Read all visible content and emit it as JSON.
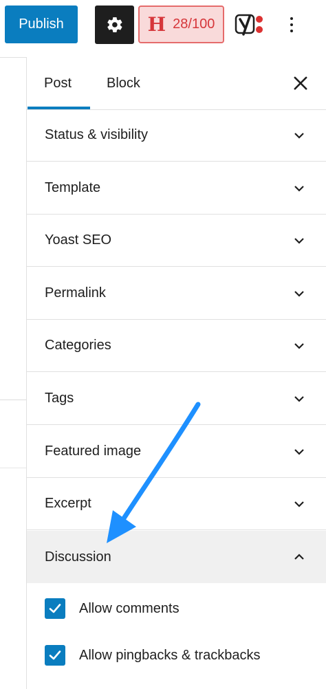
{
  "toolbar": {
    "publish_label": "Publish",
    "hemingway_score": "28/100",
    "icons": [
      "settings-gear-icon",
      "hemingway-h-icon",
      "yoast-icon",
      "more-options-icon"
    ],
    "colors": {
      "publish": "#0a7dbf",
      "settings_active": "#1e1e1e",
      "hemingway_bg": "#f9dada",
      "hemingway_text": "#d6363a"
    }
  },
  "sidebar": {
    "tabs": [
      {
        "label": "Post",
        "active": true
      },
      {
        "label": "Block",
        "active": false
      }
    ],
    "panels": [
      {
        "title": "Status & visibility",
        "expanded": false
      },
      {
        "title": "Template",
        "expanded": false
      },
      {
        "title": "Yoast SEO",
        "expanded": false
      },
      {
        "title": "Permalink",
        "expanded": false
      },
      {
        "title": "Categories",
        "expanded": false
      },
      {
        "title": "Tags",
        "expanded": false
      },
      {
        "title": "Featured image",
        "expanded": false
      },
      {
        "title": "Excerpt",
        "expanded": false
      },
      {
        "title": "Discussion",
        "expanded": true
      }
    ],
    "discussion": {
      "options": [
        {
          "label": "Allow comments",
          "checked": true
        },
        {
          "label": "Allow pingbacks & trackbacks",
          "checked": true
        }
      ]
    }
  },
  "annotation": {
    "arrow_color": "#1e90ff"
  }
}
